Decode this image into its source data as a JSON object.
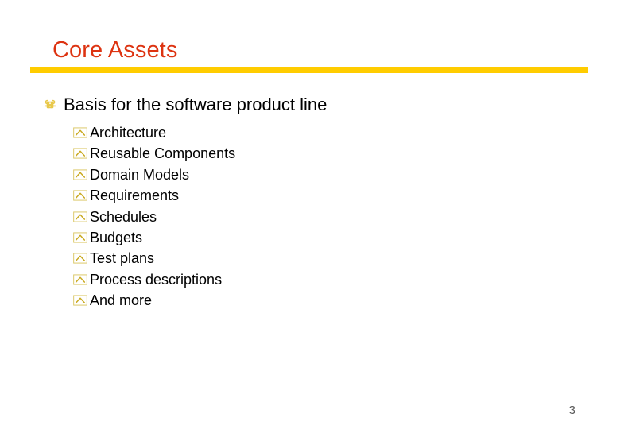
{
  "slide": {
    "title": "Core Assets",
    "title_color": "#DD3311",
    "rule_color": "#FFCC00",
    "background_color": "#FFFFFF",
    "page_number": "3",
    "page_number_color": "#5A5A5A"
  },
  "content": {
    "level1": {
      "bullet_glyph": "place-of-interest-sign",
      "bullet_color": "#E8C84A",
      "text": "Basis for the software product line",
      "text_color": "#000000"
    },
    "level2": {
      "bullet_glyph": "chevron-in-box",
      "bullet_color": "#D9C24A",
      "text_color": "#000000",
      "items": [
        {
          "label": "Architecture"
        },
        {
          "label": "Reusable Components"
        },
        {
          "label": "Domain Models"
        },
        {
          "label": "Requirements"
        },
        {
          "label": "Schedules"
        },
        {
          "label": "Budgets"
        },
        {
          "label": "Test plans"
        },
        {
          "label": "Process descriptions"
        },
        {
          "label": "And more"
        }
      ]
    }
  }
}
